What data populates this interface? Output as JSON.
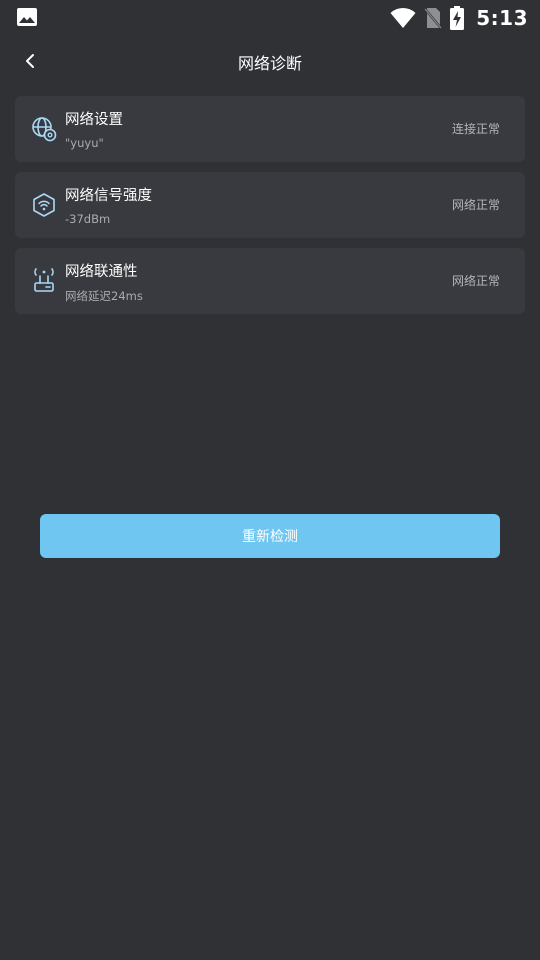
{
  "status_bar": {
    "time": "5:13",
    "icons": [
      "image-icon",
      "wifi-icon",
      "no-sim-icon",
      "battery-charging-icon"
    ]
  },
  "nav": {
    "title": "网络诊断",
    "back_icon": "chevron-left-icon"
  },
  "cards": [
    {
      "icon": "globe-settings-icon",
      "title": "网络设置",
      "subtitle": "\"yuyu\"",
      "status": "连接正常"
    },
    {
      "icon": "wifi-shield-icon",
      "title": "网络信号强度",
      "subtitle": "-37dBm",
      "status": "网络正常"
    },
    {
      "icon": "router-icon",
      "title": "网络联通性",
      "subtitle": "网络延迟24ms",
      "status": "网络正常"
    }
  ],
  "actions": {
    "retest_label": "重新检测"
  },
  "colors": {
    "background": "#303135",
    "card": "#393a3f",
    "accent": "#6fc6f1",
    "icon_tint": "#a9d9f5"
  }
}
